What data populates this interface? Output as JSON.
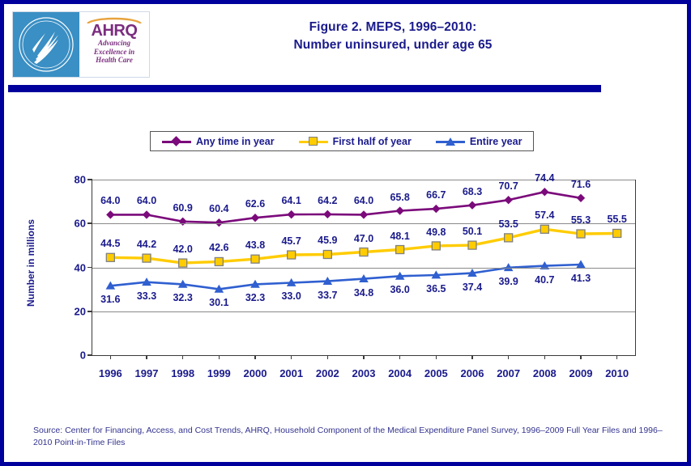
{
  "header": {
    "title_line1": "Figure 2. MEPS, 1996–2010:",
    "title_line2": "Number uninsured, under age 65",
    "logo": {
      "agency_abbr": "AHRQ",
      "tagline_line1": "Advancing",
      "tagline_line2": "Excellence in",
      "tagline_line3": "Health Care",
      "seal_name": "hhs-seal"
    }
  },
  "legend": {
    "items": [
      {
        "label": "Any time in year",
        "color": "#7b0a7b",
        "marker": "diamond"
      },
      {
        "label": "First half of year",
        "color": "#ffcc00",
        "marker": "square"
      },
      {
        "label": "Entire year",
        "color": "#2f5fd0",
        "marker": "triangle"
      }
    ]
  },
  "footer": {
    "source": "Source: Center for Financing, Access, and Cost Trends, AHRQ, Household Component of the Medical Expenditure Panel Survey, 1996–2009 Full Year Files and 1996–2010 Point-in-Time Files"
  },
  "chart_data": {
    "type": "line",
    "title": "Figure 2. MEPS, 1996–2010: Number uninsured, under age 65",
    "xlabel": "",
    "ylabel": "Number in millions",
    "categories": [
      "1996",
      "1997",
      "1998",
      "1999",
      "2000",
      "2001",
      "2002",
      "2003",
      "2004",
      "2005",
      "2006",
      "2007",
      "2008",
      "2009",
      "2010"
    ],
    "ylim": [
      0,
      80
    ],
    "yticks": [
      0,
      20,
      40,
      60,
      80
    ],
    "grid": true,
    "legend_position": "top",
    "series": [
      {
        "name": "Any time in year",
        "color": "#7b0a7b",
        "marker": "diamond",
        "values": [
          64.0,
          64.0,
          60.9,
          60.4,
          62.6,
          64.1,
          64.2,
          64.0,
          65.8,
          66.7,
          68.3,
          70.7,
          74.4,
          71.6,
          null
        ],
        "labels": [
          "64.0",
          "64.0",
          "60.9",
          "60.4",
          "62.6",
          "64.1",
          "64.2",
          "64.0",
          "65.8",
          "66.7",
          "68.3",
          "70.7",
          "74.4",
          "71.6",
          ""
        ]
      },
      {
        "name": "First half of year",
        "color": "#ffcc00",
        "marker": "square",
        "values": [
          44.5,
          44.2,
          42.0,
          42.6,
          43.8,
          45.7,
          45.9,
          47.0,
          48.1,
          49.8,
          50.1,
          53.5,
          57.4,
          55.3,
          55.5
        ],
        "labels": [
          "44.5",
          "44.2",
          "42.0",
          "42.6",
          "43.8",
          "45.7",
          "45.9",
          "47.0",
          "48.1",
          "49.8",
          "50.1",
          "53.5",
          "57.4",
          "55.3",
          "55.5"
        ]
      },
      {
        "name": "Entire year",
        "color": "#2f5fd0",
        "marker": "triangle",
        "values": [
          31.6,
          33.3,
          32.3,
          30.1,
          32.3,
          33.0,
          33.7,
          34.8,
          36.0,
          36.5,
          37.4,
          39.9,
          40.7,
          41.3,
          null
        ],
        "labels": [
          "31.6",
          "33.3",
          "32.3",
          "30.1",
          "32.3",
          "33.0",
          "33.7",
          "34.8",
          "36.0",
          "36.5",
          "37.4",
          "39.9",
          "40.7",
          "41.3",
          ""
        ]
      }
    ]
  }
}
